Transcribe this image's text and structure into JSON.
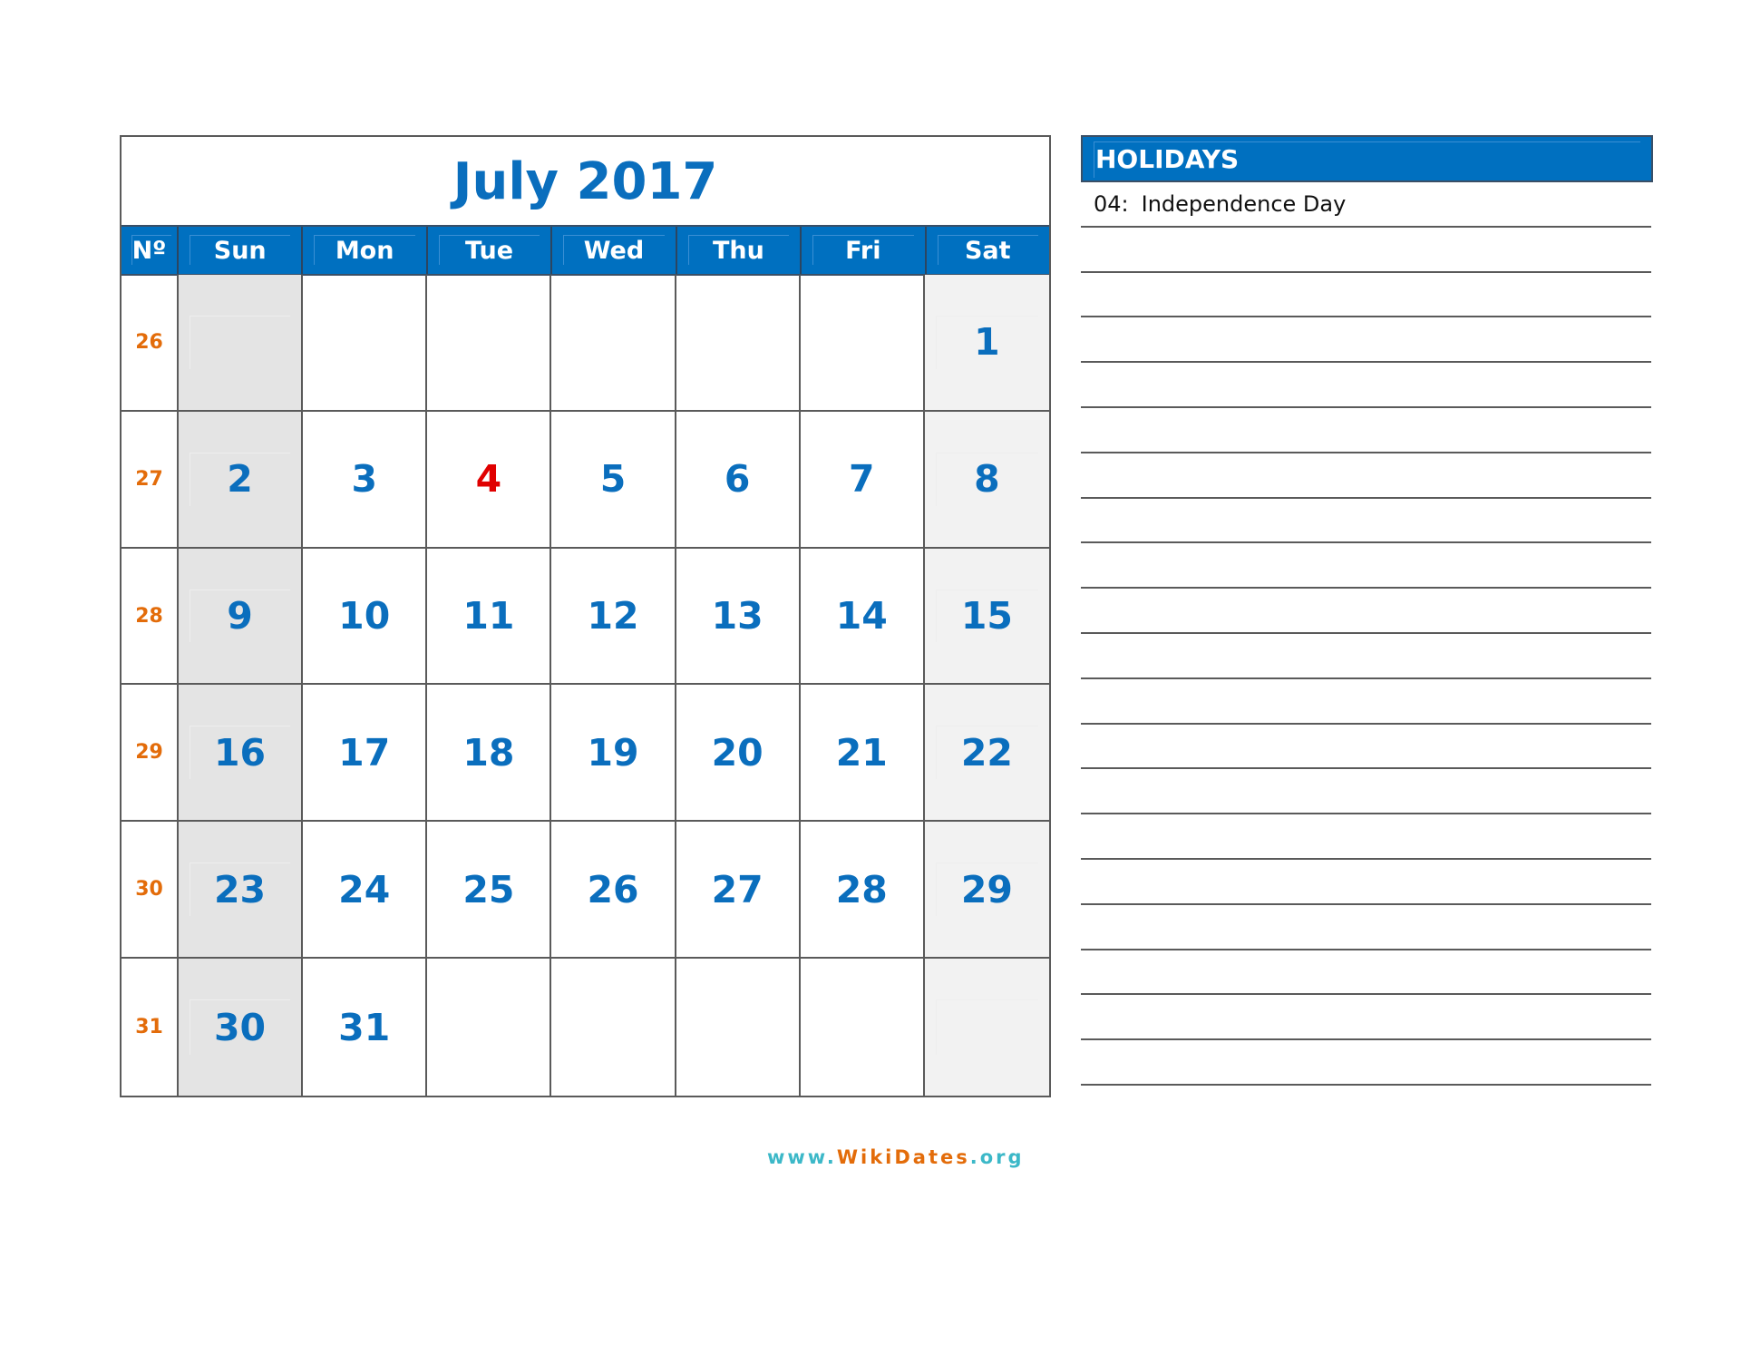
{
  "calendar": {
    "title": "July 2017",
    "week_label": "Nº",
    "days_of_week": [
      "Sun",
      "Mon",
      "Tue",
      "Wed",
      "Thu",
      "Fri",
      "Sat"
    ],
    "weeks": [
      {
        "week": "26",
        "days": [
          "",
          "",
          "",
          "",
          "",
          "",
          "1"
        ]
      },
      {
        "week": "27",
        "days": [
          "2",
          "3",
          "4",
          "5",
          "6",
          "7",
          "8"
        ]
      },
      {
        "week": "28",
        "days": [
          "9",
          "10",
          "11",
          "12",
          "13",
          "14",
          "15"
        ]
      },
      {
        "week": "29",
        "days": [
          "16",
          "17",
          "18",
          "19",
          "20",
          "21",
          "22"
        ]
      },
      {
        "week": "30",
        "days": [
          "23",
          "24",
          "25",
          "26",
          "27",
          "28",
          "29"
        ]
      },
      {
        "week": "31",
        "days": [
          "30",
          "31",
          "",
          "",
          "",
          "",
          ""
        ]
      }
    ],
    "holiday_days": [
      "4"
    ],
    "colors": {
      "accent": "#0070c0",
      "day_number": "#0a6ebd",
      "week_number": "#e36c0a",
      "holiday": "#e00000",
      "sunday_bg": "#e4e4e4",
      "saturday_bg": "#f2f2f2"
    }
  },
  "holidays": {
    "title": "HOLIDAYS",
    "items": [
      {
        "code": "04:",
        "name": "Independence Day"
      }
    ],
    "blank_lines": 19
  },
  "footer": {
    "prefix": "www.",
    "brand": "WikiDates",
    "suffix": ".org"
  }
}
